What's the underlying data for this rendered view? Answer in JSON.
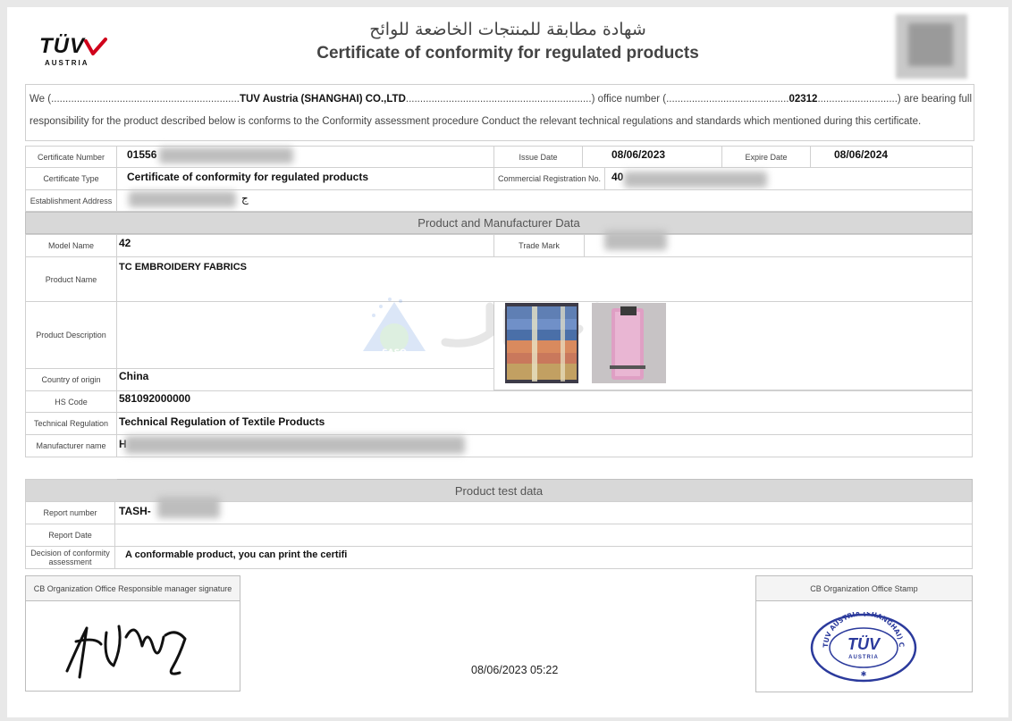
{
  "header": {
    "logo_brand": "TÜV",
    "logo_sub": "AUSTRIA",
    "title_ar": "شهادة مطابقة للمنتجات الخاضعة للوائح",
    "title_en": "Certificate of conformity for regulated products"
  },
  "intro": {
    "we_prefix": "We (",
    "dots1": "..................................................................",
    "company": "TUV Austria (SHANGHAI) CO.,LTD",
    "dots2": ".................................................................",
    "office_label": ") office number (",
    "dots3": "...........................................",
    "office_number": "02312",
    "dots4": "............................",
    "bearing": ") are bearing full",
    "line2": "responsibility for the product described below is conforms to the Conformity assessment procedure Conduct the relevant technical regulations and standards which mentioned during this certificate."
  },
  "certificate": {
    "number_label": "Certificate  Number",
    "number_value": "01556",
    "issue_label": "Issue Date",
    "issue_value": "08/06/2023",
    "expire_label": "Expire Date",
    "expire_value": "08/06/2024",
    "type_label": "Certificate Type",
    "type_value": "Certificate of conformity for regulated products",
    "commercial_label": "Commercial Registration No.",
    "commercial_value": "40",
    "address_label": "Establishment Address",
    "address_value": "ج"
  },
  "product_section": {
    "title": "Product and Manufacturer Data",
    "model_label": "Model Name",
    "model_value": "42",
    "trademark_label": "Trade Mark",
    "name_label": "Product Name",
    "name_value": "TC EMBROIDERY FABRICS",
    "description_label": "Product Description",
    "country_label": "Country of origin",
    "country_value": "China",
    "hs_label": "HS Code",
    "hs_value": "581092000000",
    "regulation_label": "Technical Regulation",
    "regulation_value": "Technical Regulation of Textile Products",
    "manufacturer_label": "Manufacturer name",
    "manufacturer_value": "H",
    "watermark_text": "SASO"
  },
  "test_section": {
    "title": "Product test data",
    "report_label": "Report number",
    "report_value": "TASH-",
    "report_date_label": "Report Date",
    "decision_label": "Decision of conformity assessment",
    "decision_value": "A conformable product, you can print the certifi"
  },
  "footer": {
    "signature_label": "CB Organization Office Responsible manager signature",
    "timestamp": "08/06/2023 05:22",
    "stamp_label": "CB Organization Office Stamp",
    "stamp_ring_text": "TUV AUSTRIA (SHANGHAI) CO.,LTD",
    "stamp_brand": "TÜV",
    "stamp_sub": "AUSTRIA"
  },
  "colors": {
    "section_bg": "#d8d8d8",
    "stamp_blue": "#2b3a9c",
    "logo_red": "#d0021b"
  }
}
